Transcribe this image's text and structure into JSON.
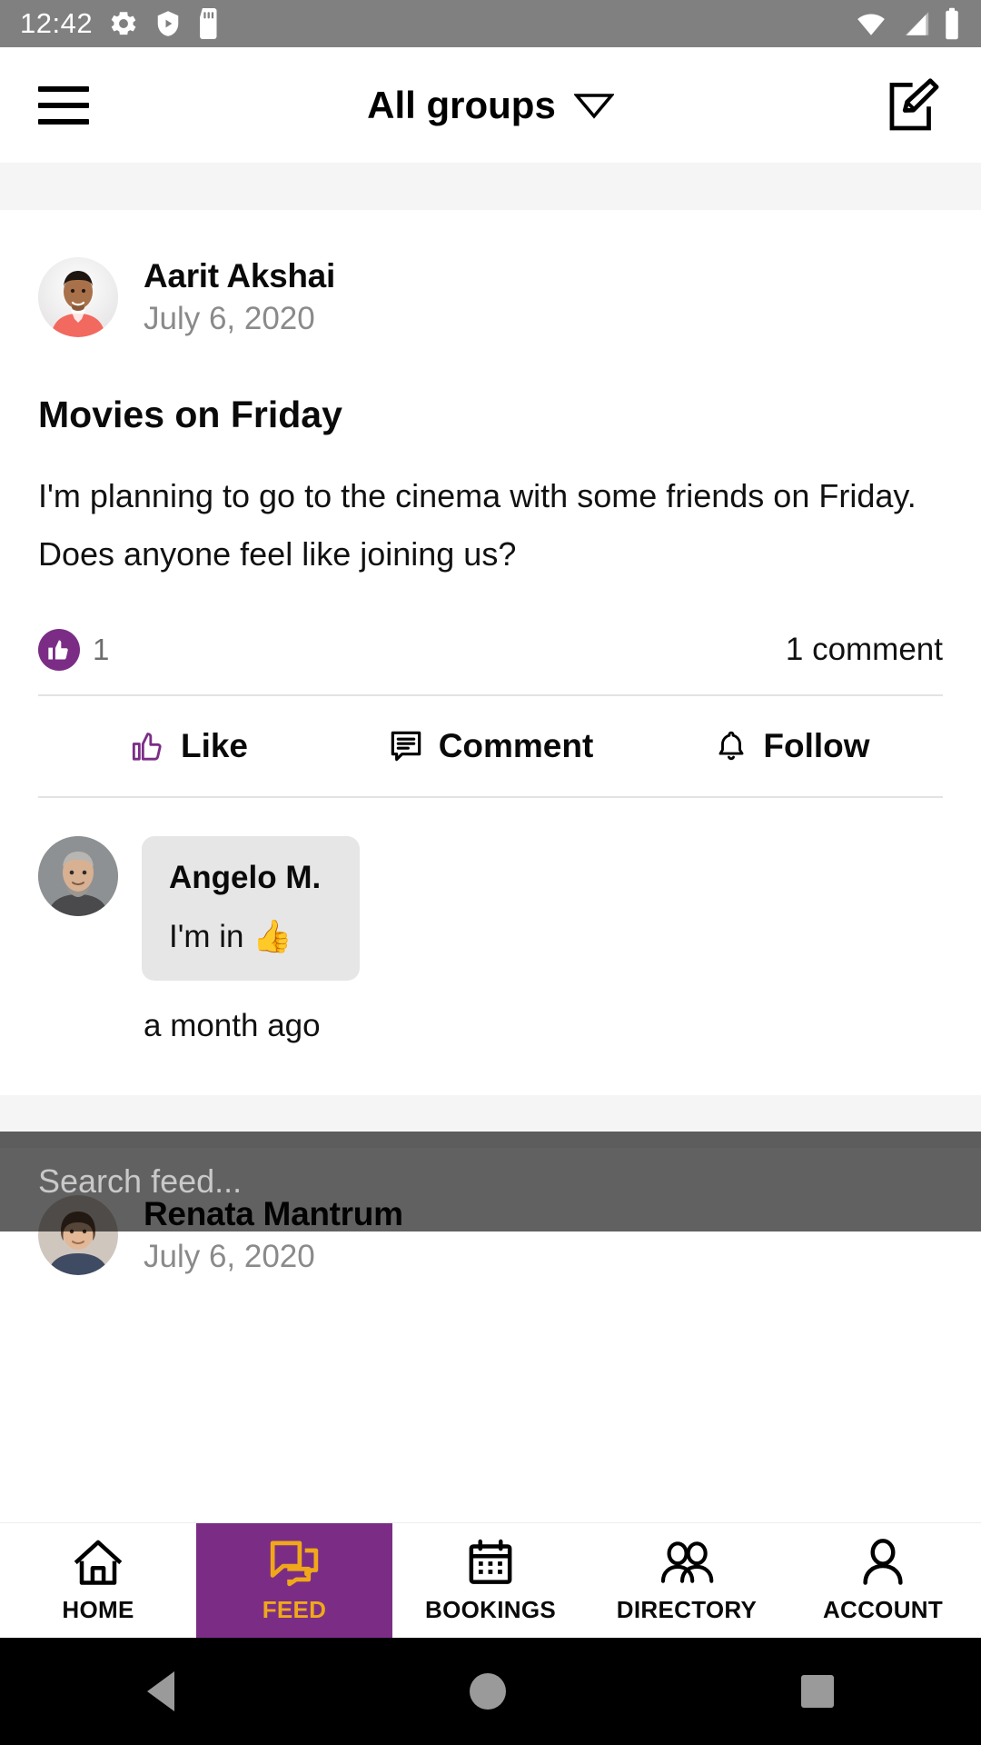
{
  "status_bar": {
    "time": "12:42",
    "left_icons": [
      "gear-icon",
      "shield-play-icon",
      "sd-card-icon"
    ],
    "right_icons": [
      "wifi-icon",
      "cellular-signal-icon",
      "battery-icon"
    ],
    "background": "#808080"
  },
  "header": {
    "menu_icon": "hamburger-menu-icon",
    "title": "All groups",
    "dropdown_icon": "chevron-down-icon",
    "compose_icon": "compose-edit-icon"
  },
  "post": {
    "author": "Aarit Akshai",
    "date": "July 6, 2020",
    "title": "Movies on Friday",
    "body": "I'm planning to go to the cinema with some friends on Friday. Does anyone feel like joining us?",
    "reaction_icon": "thumbs-up-filled-icon",
    "reaction_count": "1",
    "comment_count": "1 comment",
    "actions": [
      {
        "label": "Like",
        "icon": "thumbs-up-outline-icon"
      },
      {
        "label": "Comment",
        "icon": "comment-bubble-icon"
      },
      {
        "label": "Follow",
        "icon": "bell-icon"
      }
    ],
    "comments": [
      {
        "author": "Angelo M.",
        "text": "I'm in 👍",
        "time": "a month ago"
      }
    ]
  },
  "next_post": {
    "author": "Renata Mantrum",
    "date": "July 6, 2020"
  },
  "search": {
    "placeholder": "Search feed..."
  },
  "bottom_nav": {
    "items": [
      {
        "label": "HOME",
        "icon": "home-icon",
        "active": false
      },
      {
        "label": "FEED",
        "icon": "feed-chat-icon",
        "active": true
      },
      {
        "label": "BOOKINGS",
        "icon": "calendar-icon",
        "active": false
      },
      {
        "label": "DIRECTORY",
        "icon": "people-icon",
        "active": false
      },
      {
        "label": "ACCOUNT",
        "icon": "person-icon",
        "active": false
      }
    ],
    "active_bg": "#7b2d86",
    "active_fg": "#f0a819"
  },
  "system_nav": {
    "back_icon": "back-triangle-icon",
    "home_icon": "home-circle-icon",
    "recents_icon": "recents-square-icon"
  },
  "colors": {
    "brand_purple": "#7b2d86",
    "accent_amber": "#f0a819",
    "status_gray": "#808080",
    "bubble_gray": "#e6e6e6"
  }
}
